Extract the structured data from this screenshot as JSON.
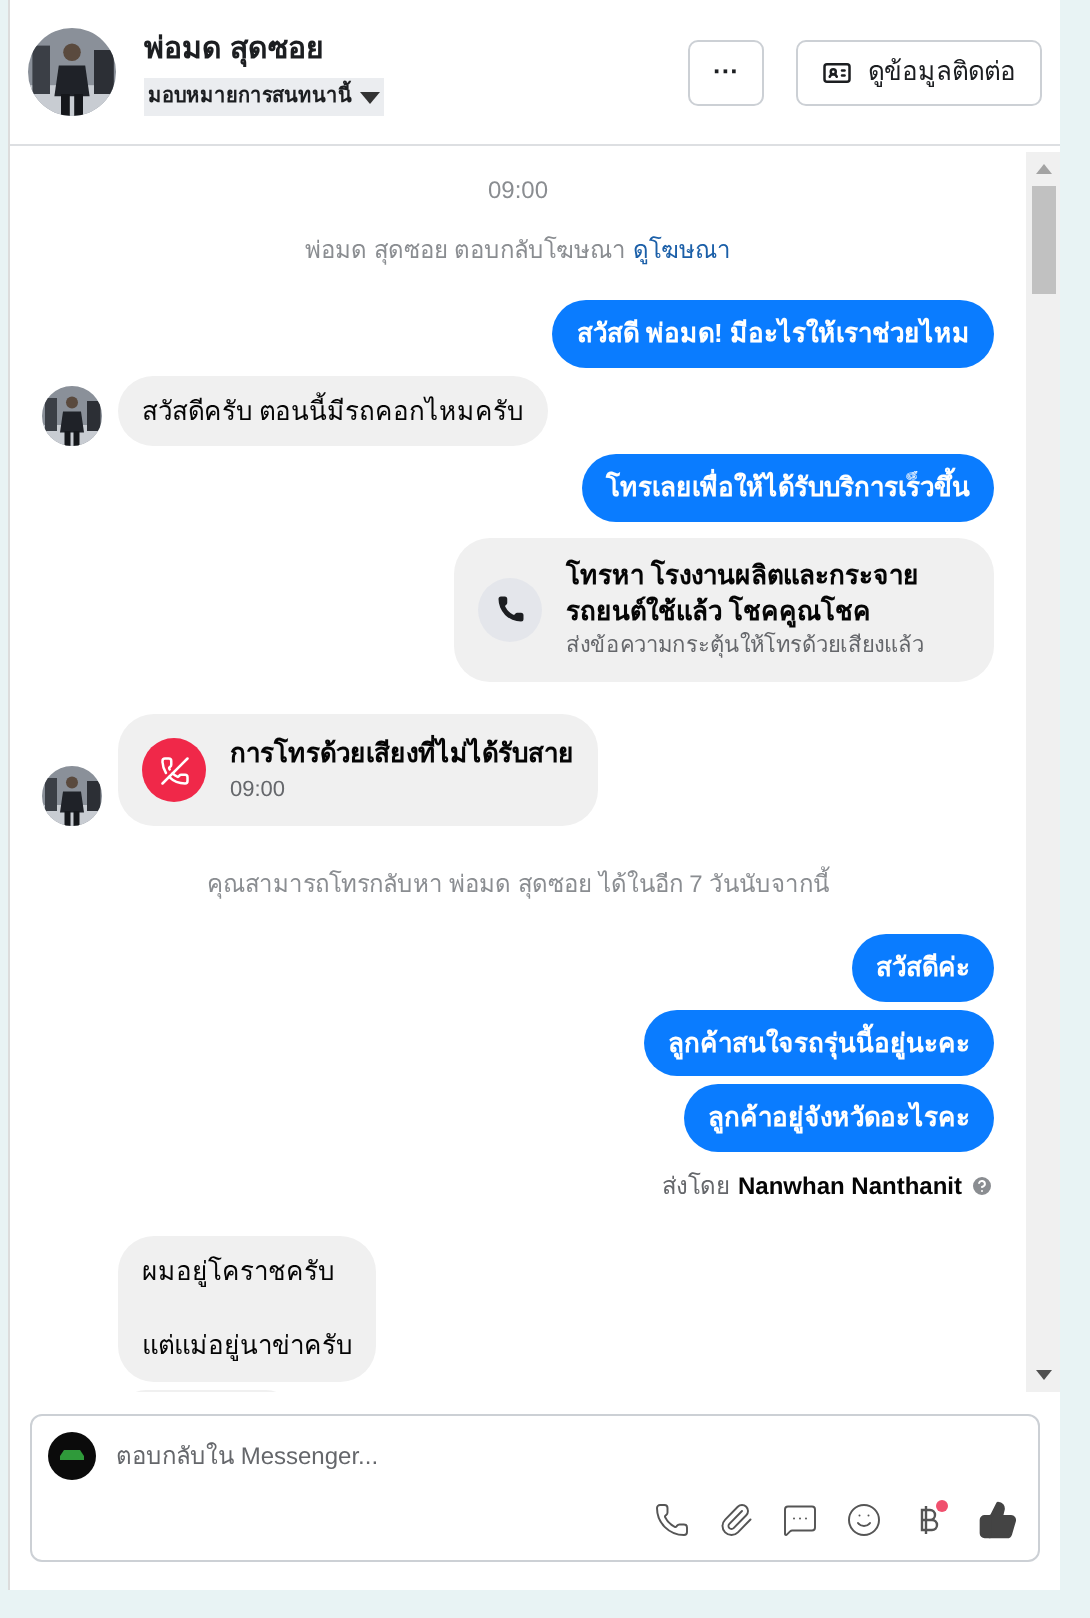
{
  "header": {
    "name": "พ่อมด สุดซอย",
    "assign": "มอบหมายการสนทนานี้",
    "more_label": "···",
    "contact_button": "ดูข้อมูลติดต่อ"
  },
  "messages": [
    {
      "kind": "time",
      "text": "09:00"
    },
    {
      "kind": "system",
      "text": "พ่อมด สุดซอย ตอบกลับโฆษณา",
      "link": "ดูโฆษณา"
    },
    {
      "kind": "out",
      "text": "สวัสดี พ่อมด! มีอะไรให้เราช่วยไหม"
    },
    {
      "kind": "in",
      "avatar": true,
      "lines": [
        "สวัสดีครับ  ตอนนี้มีรถคอกไหมครับ"
      ]
    },
    {
      "kind": "out",
      "text": "โทรเลยเพื่อให้ได้รับบริการเร็วขึ้น"
    },
    {
      "kind": "call_prompt",
      "title": "โทรหา โรงงานผลิตและกระจาย รถยนต์ใช้แล้ว โชคคูณโชค",
      "subtitle": "ส่งข้อความกระตุ้นให้โทรด้วยเสียงแล้ว"
    },
    {
      "kind": "missed_call",
      "avatar": true,
      "title": "การโทรด้วยเสียงที่ไม่ได้รับสาย",
      "time": "09:00"
    },
    {
      "kind": "system",
      "text": "คุณสามารถโทรกลับหา พ่อมด สุดซอย ได้ในอีก 7 วันนับจากนี้"
    },
    {
      "kind": "out",
      "text": "สวัสดีค่ะ"
    },
    {
      "kind": "out",
      "text": "ลูกค้าสนใจรถรุ่นนี้อยู่นะคะ"
    },
    {
      "kind": "out",
      "text": "ลูกค้าอยู่จังหวัดอะไรคะ"
    },
    {
      "kind": "sent_by",
      "label": "ส่งโดย",
      "name": "Nanwhan Nanthanit"
    },
    {
      "kind": "in",
      "avatar": false,
      "lines": [
        "ผมอยู่โคราชครับ",
        "แต่แม่อยู่นาข่าครับ"
      ]
    },
    {
      "kind": "in_clipped"
    }
  ],
  "composer": {
    "placeholder": "ตอบกลับใน Messenger..."
  }
}
